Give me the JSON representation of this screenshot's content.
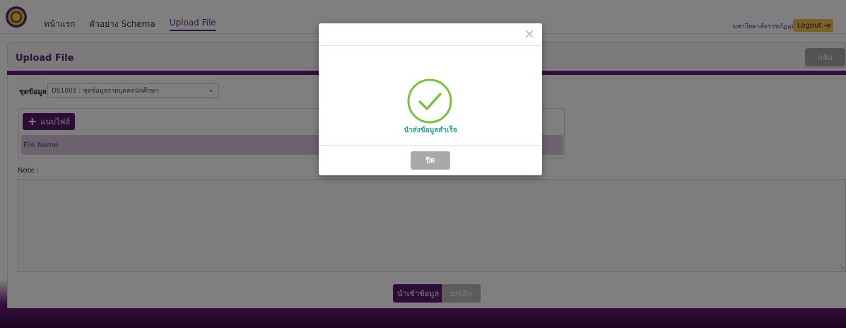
{
  "nav": {
    "items": [
      {
        "label": "หน้าแรก"
      },
      {
        "label": "ตัวอย่าง Schema"
      },
      {
        "label": "Upload File",
        "active": true
      }
    ],
    "university": "มหาวิทยาลัยราชภัฏอุตรดิตถ์",
    "logout_label": "Logout",
    "logout_icon": "sign-out-icon"
  },
  "page": {
    "title": "Upload File",
    "back_label": "กลับ"
  },
  "form": {
    "dataset_label": "ชุดข้อมูล",
    "dataset_value": "DS1001 : ชุดข้อมูลรายบุคคลนักศึกษา",
    "attach_label": "แนบไฟล์",
    "file_column": "File Name",
    "note_label": "Note :",
    "note_value": "",
    "import_label": "นำเข้าข้อมูล",
    "cancel_label": "ยกเลิก"
  },
  "modal": {
    "close_glyph": "×",
    "message": "นำส่งข้อมูลสำเร็จ",
    "close_button": "ปิด",
    "icon": "check-circle-icon",
    "success_color": "#7ac142"
  },
  "colors": {
    "brand_purple": "#5b1a6e",
    "accent_gold": "#f2c14e"
  }
}
